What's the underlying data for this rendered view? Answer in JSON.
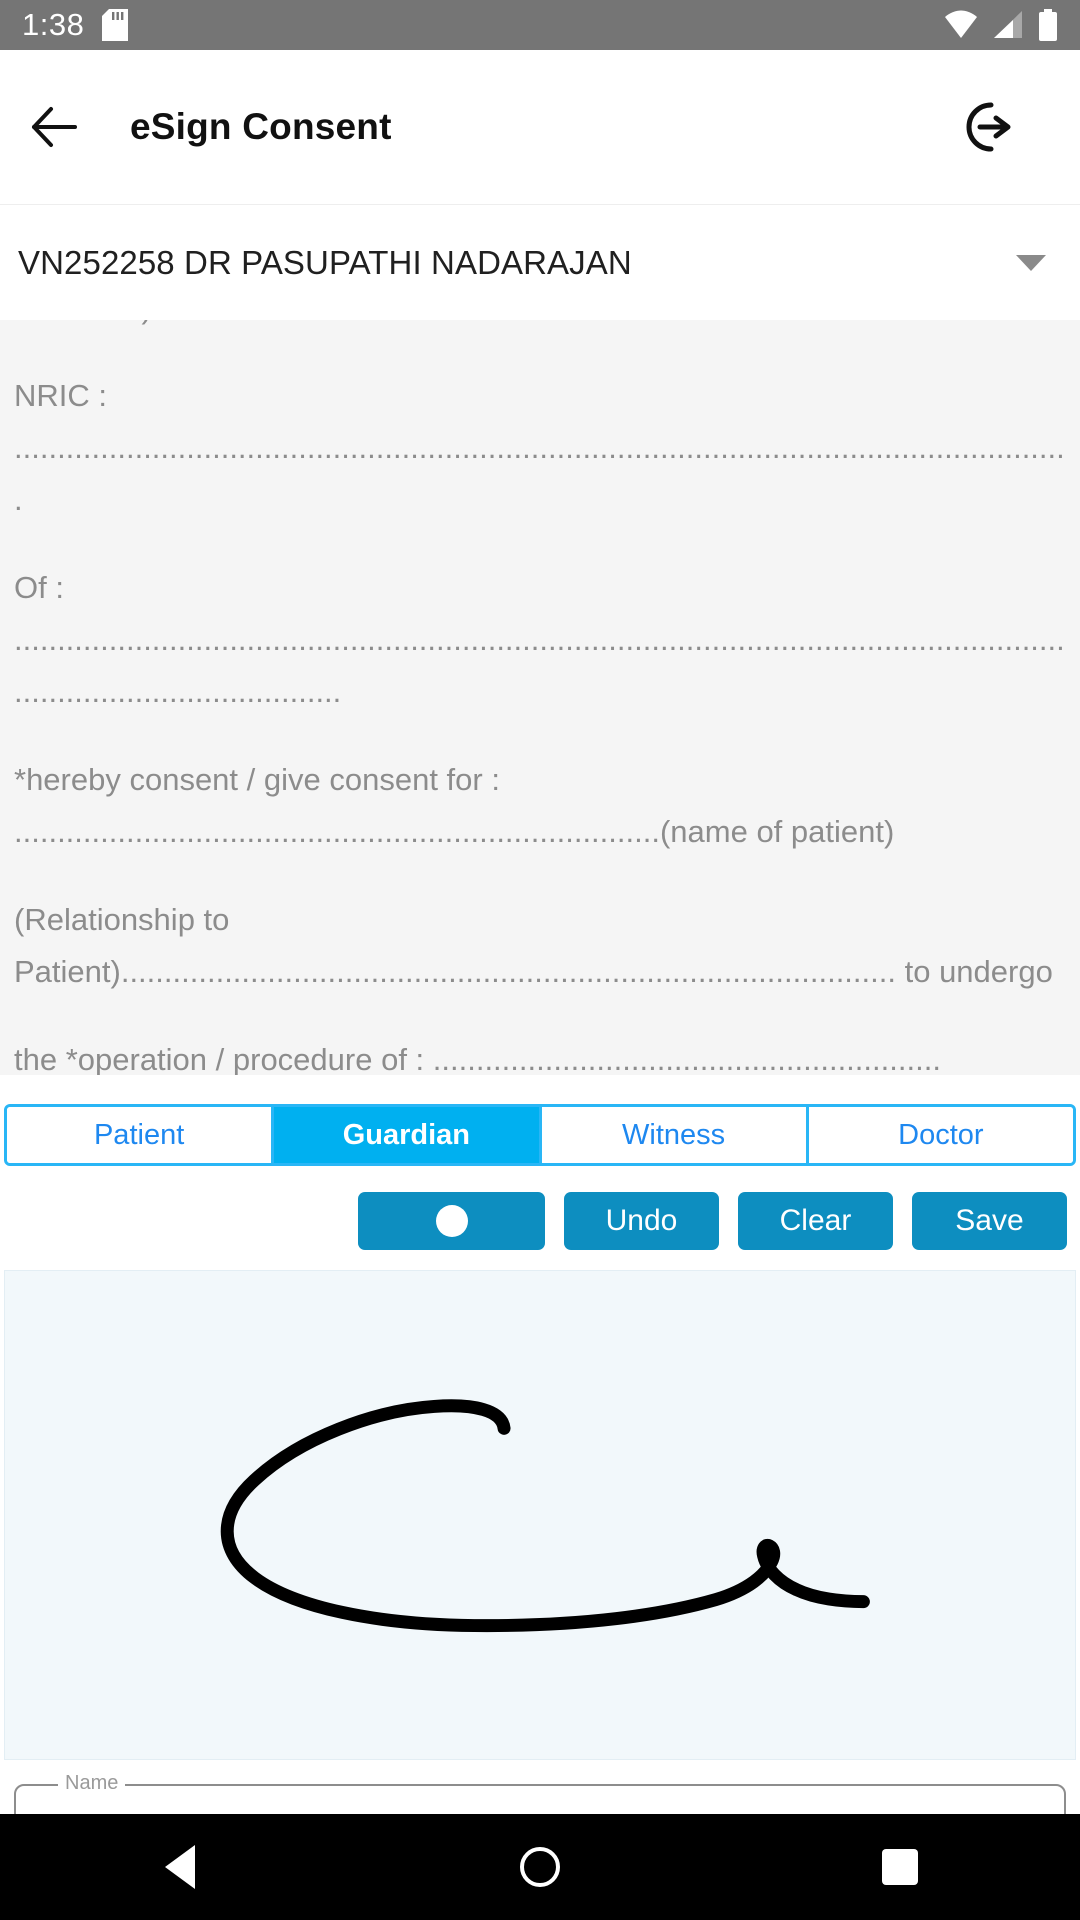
{
  "statusbar": {
    "time": "1:38",
    "icons": [
      "sd-card-icon",
      "wifi-icon",
      "cellular-signal-icon",
      "battery-icon"
    ]
  },
  "appbar": {
    "back_icon": "arrow-left-icon",
    "title": "eSign Consent",
    "logout_icon": "logout-icon"
  },
  "visit_selector": {
    "value": "VN252258 DR PASUPATHI NADARAJAN",
    "caret_icon": "chevron-down-icon",
    "options": [
      "VN252258 DR PASUPATHI NADARAJAN"
    ]
  },
  "consent": {
    "paragraphs": [
      "Guardian)",
      "NRIC : ...........................................................................................................................",
      "Of : ................................................................................................................................................................",
      "*hereby consent / give consent for : ...........................................................................(name of patient)",
      "(Relationship to Patient).......................................................................................... to undergo",
      "the *operation / procedure of : ..........................................................."
    ]
  },
  "signer_tabs": {
    "items": [
      {
        "label": "Patient",
        "active": false
      },
      {
        "label": "Guardian",
        "active": true
      },
      {
        "label": "Witness",
        "active": false
      },
      {
        "label": "Doctor",
        "active": false
      }
    ],
    "active_color": "#00b0f0",
    "border_color": "#29b6f6",
    "inactive_text_color": "#1e88f0"
  },
  "pad_actions": {
    "pen_icon": "pen-dot-icon",
    "pen_label": "",
    "undo_label": "Undo",
    "clear_label": "Clear",
    "save_label": "Save",
    "button_color": "#0d8ec0"
  },
  "signature_pad": {
    "background_color": "#f2f8fb",
    "stroke_color": "#000000",
    "has_signature": true
  },
  "name_field": {
    "label": "Name",
    "value": "",
    "placeholder": ""
  },
  "navbar": {
    "back_icon": "nav-back-icon",
    "home_icon": "nav-home-icon",
    "recents_icon": "nav-recents-icon"
  }
}
